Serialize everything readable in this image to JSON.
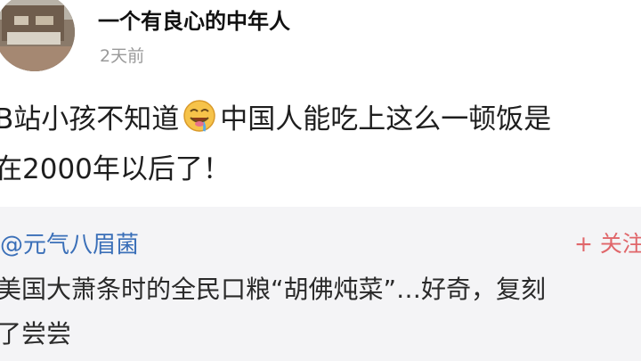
{
  "post": {
    "author_name": "一个有良心的中年人",
    "timestamp": "2天前",
    "avatar_icon": "avatar-photo",
    "content_line1_before": "B站小孩不知道",
    "content_emoji": "drooling-face-emoji",
    "content_line1_after": "中国人能吃上这么一顿饭是",
    "content_line2": "在2000年以后了！"
  },
  "quoted": {
    "mention": "@元气八眉菌",
    "follow_label": "+ 关注",
    "text_line1": "美国大萧条时的全民口粮“胡佛炖菜”…好奇，复刻",
    "text_line2": "了尝尝"
  },
  "colors": {
    "mention": "#3a6fb8",
    "follow": "#e0666a",
    "timestamp": "#9a9a9a",
    "quote_background": "#f4f4f6"
  }
}
